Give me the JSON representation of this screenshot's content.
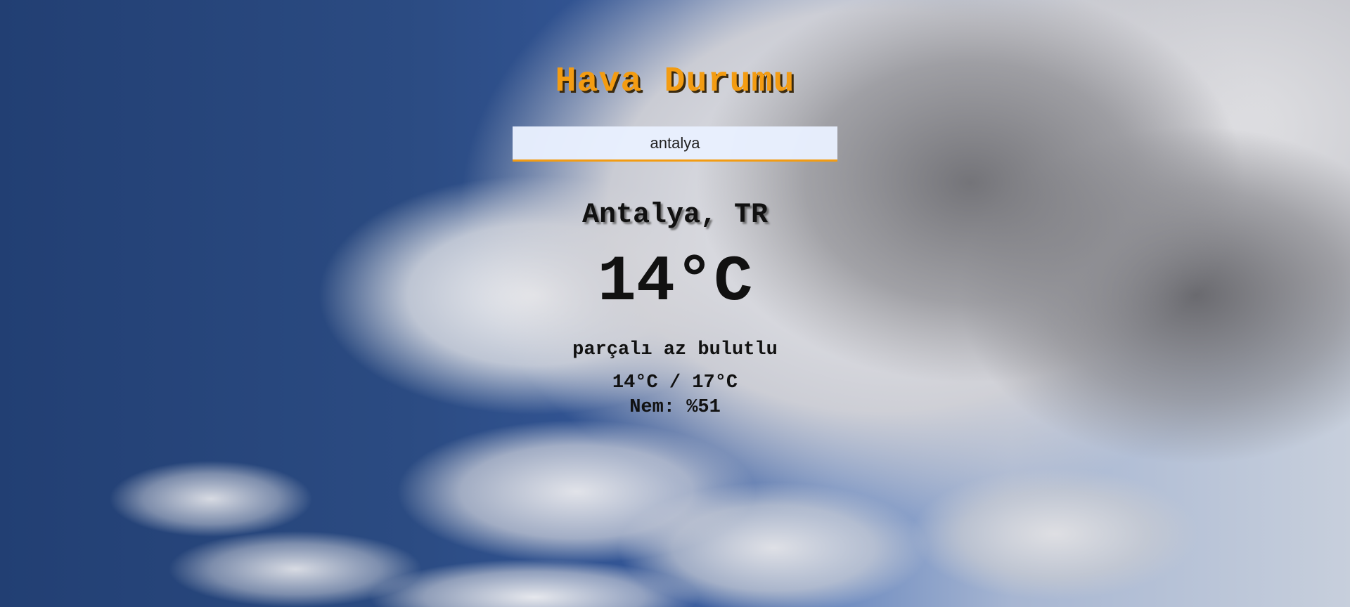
{
  "app": {
    "title": "Hava Durumu"
  },
  "search": {
    "value": "antalya",
    "placeholder": ""
  },
  "weather": {
    "city": "Antalya, TR",
    "temperature": "14°C",
    "description": "parçalı az bulutlu",
    "min_max": "14°C / 17°C",
    "humidity": "Nem: %51"
  },
  "colors": {
    "accent": "#f39c12",
    "text": "#111111",
    "input_bg": "#e8f0fe"
  }
}
